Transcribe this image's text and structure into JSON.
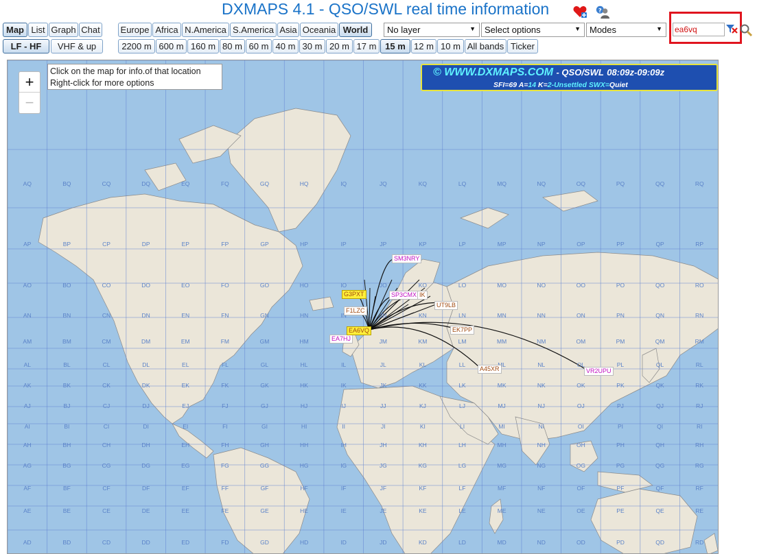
{
  "header": {
    "title": "DXMAPS 4.1 - QSO/SWL real time information"
  },
  "view_tabs": [
    {
      "label": "Map",
      "active": true
    },
    {
      "label": "List",
      "active": false
    },
    {
      "label": "Graph",
      "active": false
    },
    {
      "label": "Chat",
      "active": false
    }
  ],
  "band_groups": [
    {
      "label": "LF - HF",
      "active": true
    },
    {
      "label": "VHF & up",
      "active": false
    }
  ],
  "regions": [
    {
      "label": "Europe",
      "active": false
    },
    {
      "label": "Africa",
      "active": false
    },
    {
      "label": "N.America",
      "active": false
    },
    {
      "label": "S.America",
      "active": false
    },
    {
      "label": "Asia",
      "active": false
    },
    {
      "label": "Oceania",
      "active": false
    },
    {
      "label": "World",
      "active": true
    }
  ],
  "bands": [
    {
      "label": "2200 m",
      "active": false
    },
    {
      "label": "600 m",
      "active": false
    },
    {
      "label": "160 m",
      "active": false
    },
    {
      "label": "80 m",
      "active": false
    },
    {
      "label": "60 m",
      "active": false
    },
    {
      "label": "40 m",
      "active": false
    },
    {
      "label": "30 m",
      "active": false
    },
    {
      "label": "20 m",
      "active": false
    },
    {
      "label": "17 m",
      "active": false
    },
    {
      "label": "15 m",
      "active": true
    },
    {
      "label": "12 m",
      "active": false
    },
    {
      "label": "10 m",
      "active": false
    },
    {
      "label": "All bands",
      "active": false
    },
    {
      "label": "Ticker",
      "active": false
    }
  ],
  "dropdowns": {
    "layer": "No layer",
    "options": "Select options",
    "modes": "Modes"
  },
  "search": {
    "value": "ea6vq"
  },
  "map": {
    "tooltip_line1": "Click on the map for info.of that location",
    "tooltip_line2": "Right-click for more options",
    "zoom_in": "+",
    "zoom_out": "−",
    "banner": {
      "site": "© WWW.DXMAPS.COM",
      "mode": "- QSO/SWL",
      "time": "08:09z-09:09z",
      "sfi_label": "SFI=",
      "sfi": "69",
      "a_label": "A=",
      "a": "14",
      "k_label": "K=",
      "k": "2-Unsettled",
      "swx_label": "SWX=",
      "swx": "Quiet"
    },
    "grid_columns": [
      "A",
      "B",
      "C",
      "D",
      "E",
      "F",
      "G",
      "H",
      "I",
      "J",
      "K",
      "L",
      "M",
      "N",
      "O",
      "P",
      "Q",
      "R"
    ],
    "grid_rows": [
      "Q",
      "P",
      "O",
      "N",
      "M",
      "L",
      "K",
      "J",
      "I",
      "H",
      "G",
      "F",
      "E",
      "D"
    ],
    "home_station": "EA6VQ",
    "stations": [
      {
        "call": "SM3NRY",
        "style": "magenta"
      },
      {
        "call": "G3PXT",
        "style": "yellow"
      },
      {
        "call": "SP3CMX",
        "style": "magenta"
      },
      {
        "call": "IK",
        "style": "brown"
      },
      {
        "call": "UT9LB",
        "style": "brown"
      },
      {
        "call": "F1LZC",
        "style": "brown"
      },
      {
        "call": "EK7PP",
        "style": "brown"
      },
      {
        "call": "EA7HJ",
        "style": "magenta"
      },
      {
        "call": "A45XR",
        "style": "brown"
      },
      {
        "call": "VR2UPU",
        "style": "magenta"
      }
    ]
  },
  "colors": {
    "title": "#1a73c8",
    "ocean": "#9fc5e6",
    "land": "#ebe6d9",
    "highlight": "#e0141e"
  }
}
